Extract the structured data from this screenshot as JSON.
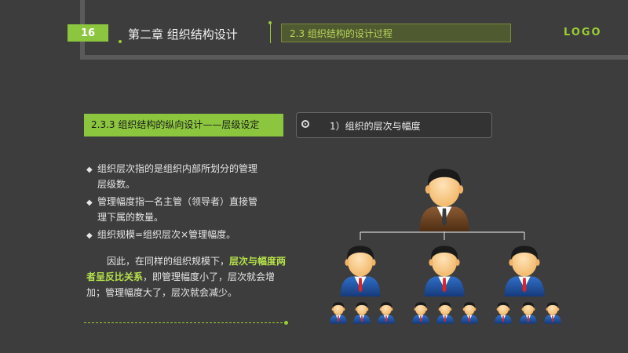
{
  "header": {
    "page_number": "16",
    "chapter_title": "第二章  组织结构设计",
    "section_title": "2.3 组织结构的设计过程",
    "logo": "LOGO"
  },
  "subheaders": {
    "left": "2.3.3  组织结构的纵向设计——层级设定",
    "right": "1）组织的层次与幅度"
  },
  "bullets": [
    {
      "line1": "组织层次指的是组织内部所划分的管理",
      "line2": "层级数。"
    },
    {
      "line1": "管理幅度指一名主管（领导者）直接管",
      "line2": "理下属的数量。"
    },
    {
      "line1": "组织规模=组织层次×管理幅度。",
      "line2": ""
    }
  ],
  "paragraph": {
    "part1": "因此，在同样的组织规模下，",
    "highlight1": "层次与",
    "highlight2": "幅度两者呈反比关系",
    "part2": "，即管理幅度小了，层次就会增加；管理幅度大了，层次就会减少。"
  },
  "colors": {
    "accent": "#8cc63f",
    "background": "#3d3d3d",
    "highlight": "#b5e14a",
    "tie": "#d7262c"
  },
  "org_chart": {
    "levels": [
      1,
      3,
      9
    ],
    "icon": "person-icon"
  }
}
